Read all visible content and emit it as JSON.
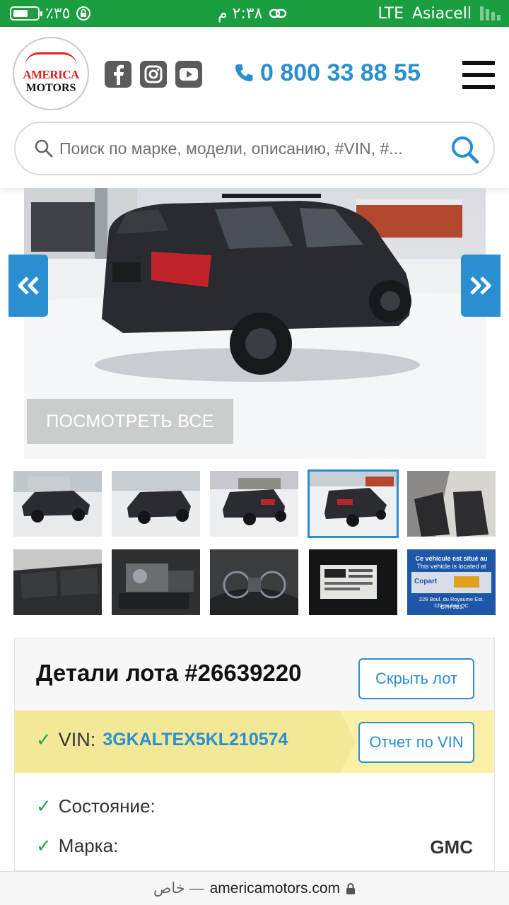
{
  "status_bar": {
    "battery_percent": "٪٣٥",
    "time": "٢:٣٨ م",
    "network": "LTE",
    "carrier": "Asiacell"
  },
  "header": {
    "logo": {
      "line1": "AMERICA",
      "line2": "MOTORS"
    },
    "social": [
      {
        "icon": "facebook-icon"
      },
      {
        "icon": "instagram-icon"
      },
      {
        "icon": "youtube-icon"
      }
    ],
    "phone": "0 800 33 88 55",
    "menu_icon": "hamburger-menu-icon",
    "search_placeholder": "Поиск по марке, модели, описанию, #VIN, #..."
  },
  "gallery": {
    "view_all_label": "ПОСМОТРЕТЬ ВСЕ",
    "prev_icon": "chevrons-left-icon",
    "next_icon": "chevrons-right-icon",
    "active_thumb": 4,
    "thumbnails": [
      "front-left-exterior",
      "front-right-exterior",
      "rear-right-exterior",
      "rear-left-exterior",
      "front-seats",
      "rear-seats",
      "engine-bay",
      "instrument-cluster",
      "door-sticker",
      "location-card"
    ],
    "location_card": {
      "line1": "Ce véhicule est situé au",
      "line2": "This vehicle is located at",
      "brand": "Copart",
      "address": "228 Boul. du Royaume Est, Chicoutimi QC",
      "postal": "G7H 5B1"
    }
  },
  "lot": {
    "title": "Детали лота #26639220",
    "hide_button": "Скрыть лот",
    "vin_label": "VIN:",
    "vin_value": "3GKALTEX5KL210574",
    "vin_report_button": "Отчет по VIN",
    "details": [
      {
        "label": "Состояние:",
        "value": ""
      },
      {
        "label": "Марка:",
        "value": "GMC"
      }
    ]
  },
  "bottom_bar": {
    "private_label": "خاص —",
    "domain": "americamotors.com",
    "lock_icon": "lock-icon"
  },
  "colors": {
    "status_green": "#1a9e3f",
    "accent_blue": "#2a8fd0",
    "check_green": "#1faa4a",
    "vin_yellow": "#faf0a6"
  }
}
